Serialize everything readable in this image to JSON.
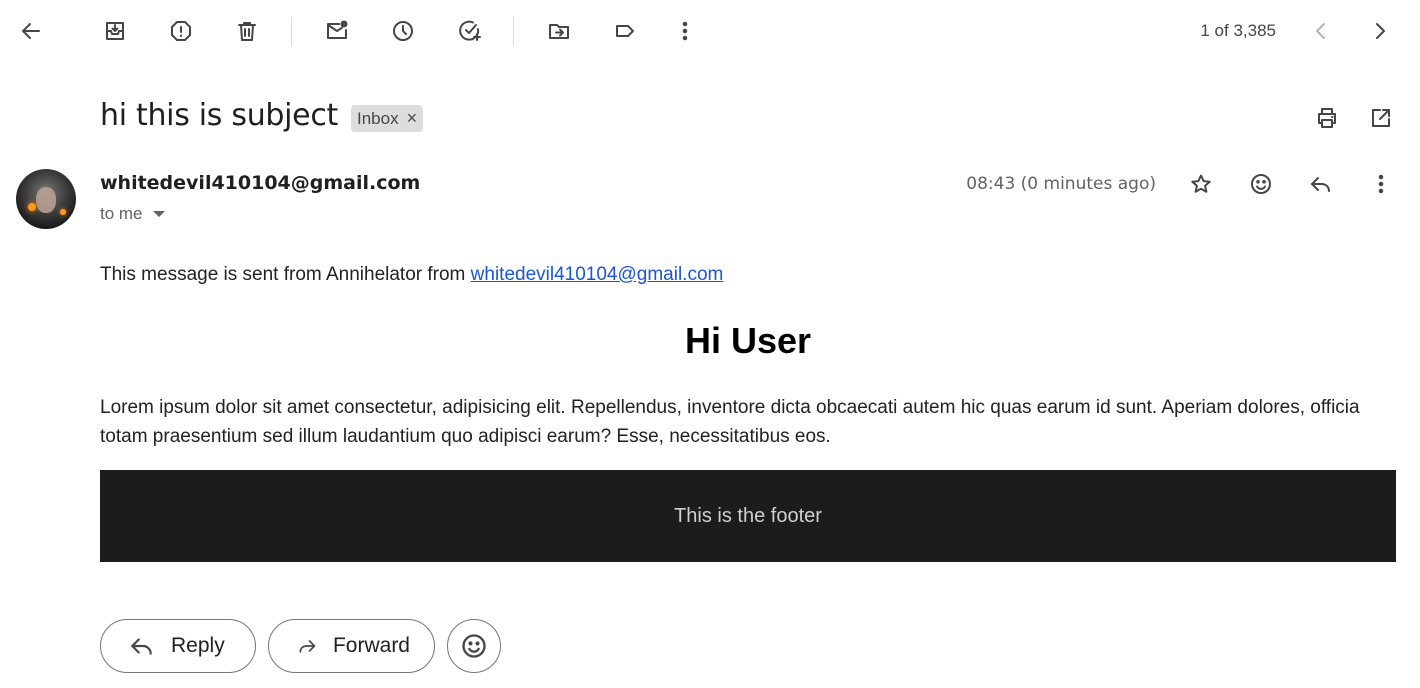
{
  "toolbar": {
    "icons": [
      "back-arrow-icon",
      "archive-icon",
      "report-spam-icon",
      "delete-icon",
      "mark-unread-icon",
      "snooze-icon",
      "add-task-icon",
      "move-to-icon",
      "labels-icon",
      "more-vert-icon"
    ],
    "pager_text": "1 of 3,385",
    "pager_icons": [
      "chevron-left-icon",
      "chevron-right-icon"
    ]
  },
  "header": {
    "subject": "hi this is subject",
    "label_chip": "Inbox",
    "label_remove": "×",
    "icons": [
      "print-icon",
      "open-new-window-icon"
    ]
  },
  "message": {
    "sender": "whitedevil410104@gmail.com",
    "recipient": "to me",
    "timestamp": "08:43 (0 minutes ago)",
    "icons": [
      "star-icon",
      "emoji-reaction-icon",
      "reply-icon",
      "more-vert-icon"
    ],
    "intro_text": "This message is sent from Annihelator from ",
    "intro_link": "whitedevil410104@gmail.com",
    "greeting": "Hi User",
    "lorem": "Lorem ipsum dolor sit amet consectetur, adipisicing elit. Repellendus, inventore dicta obcaecati autem hic quas earum id sunt. Aperiam dolores, officia totam praesentium sed illum laudantium quo adipisci earum? Esse, necessitatibus eos.",
    "footer_text": "This is the footer"
  },
  "actions": {
    "reply_label": "Reply",
    "forward_label": "Forward"
  },
  "colors": {
    "link": "#1a57d3",
    "footer_bg": "#1c1c1c",
    "footer_text": "#cfcfcf",
    "chip_bg": "#dddddd"
  }
}
